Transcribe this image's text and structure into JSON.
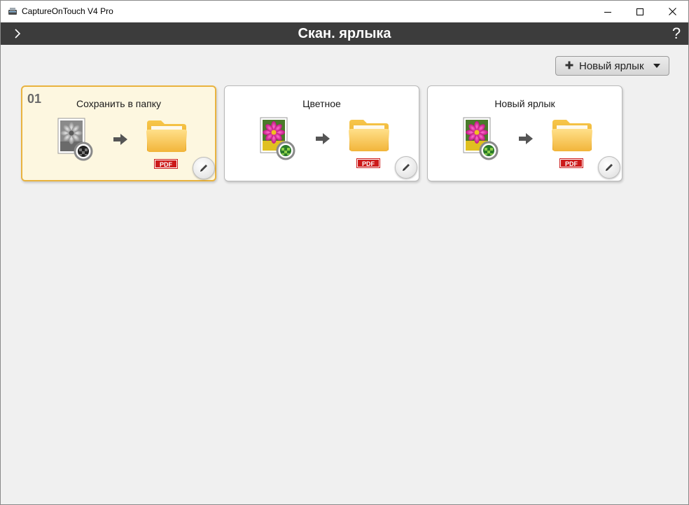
{
  "window": {
    "title": "CaptureOnTouch V4 Pro"
  },
  "header": {
    "title": "Скан. ярлыка",
    "help_label": "?"
  },
  "toolbar": {
    "new_shortcut_label": "Новый ярлык"
  },
  "cards": [
    {
      "number": "01",
      "title": "Сохранить в папку",
      "format": "PDF",
      "mode": "grayscale",
      "selected": true
    },
    {
      "number": "",
      "title": "Цветное",
      "format": "PDF",
      "mode": "color",
      "selected": false
    },
    {
      "number": "",
      "title": "Новый ярлык",
      "format": "PDF",
      "mode": "color",
      "selected": false
    }
  ],
  "colors": {
    "header_bg": "#3c3c3c",
    "selected_border": "#e9b33f",
    "selected_bg": "#fdf7e0",
    "pdf_badge": "#cc1a1a"
  }
}
